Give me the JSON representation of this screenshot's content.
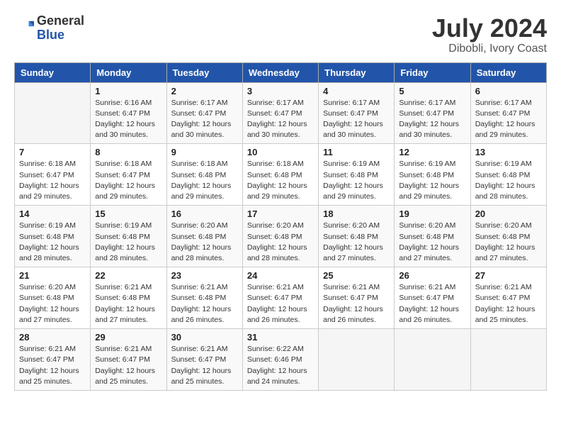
{
  "header": {
    "logo_general": "General",
    "logo_blue": "Blue",
    "month_year": "July 2024",
    "location": "Dibobli, Ivory Coast"
  },
  "days_of_week": [
    "Sunday",
    "Monday",
    "Tuesday",
    "Wednesday",
    "Thursday",
    "Friday",
    "Saturday"
  ],
  "weeks": [
    [
      {
        "day": "",
        "detail": ""
      },
      {
        "day": "1",
        "detail": "Sunrise: 6:16 AM\nSunset: 6:47 PM\nDaylight: 12 hours\nand 30 minutes."
      },
      {
        "day": "2",
        "detail": "Sunrise: 6:17 AM\nSunset: 6:47 PM\nDaylight: 12 hours\nand 30 minutes."
      },
      {
        "day": "3",
        "detail": "Sunrise: 6:17 AM\nSunset: 6:47 PM\nDaylight: 12 hours\nand 30 minutes."
      },
      {
        "day": "4",
        "detail": "Sunrise: 6:17 AM\nSunset: 6:47 PM\nDaylight: 12 hours\nand 30 minutes."
      },
      {
        "day": "5",
        "detail": "Sunrise: 6:17 AM\nSunset: 6:47 PM\nDaylight: 12 hours\nand 30 minutes."
      },
      {
        "day": "6",
        "detail": "Sunrise: 6:17 AM\nSunset: 6:47 PM\nDaylight: 12 hours\nand 29 minutes."
      }
    ],
    [
      {
        "day": "7",
        "detail": "Sunrise: 6:18 AM\nSunset: 6:47 PM\nDaylight: 12 hours\nand 29 minutes."
      },
      {
        "day": "8",
        "detail": "Sunrise: 6:18 AM\nSunset: 6:47 PM\nDaylight: 12 hours\nand 29 minutes."
      },
      {
        "day": "9",
        "detail": "Sunrise: 6:18 AM\nSunset: 6:48 PM\nDaylight: 12 hours\nand 29 minutes."
      },
      {
        "day": "10",
        "detail": "Sunrise: 6:18 AM\nSunset: 6:48 PM\nDaylight: 12 hours\nand 29 minutes."
      },
      {
        "day": "11",
        "detail": "Sunrise: 6:19 AM\nSunset: 6:48 PM\nDaylight: 12 hours\nand 29 minutes."
      },
      {
        "day": "12",
        "detail": "Sunrise: 6:19 AM\nSunset: 6:48 PM\nDaylight: 12 hours\nand 29 minutes."
      },
      {
        "day": "13",
        "detail": "Sunrise: 6:19 AM\nSunset: 6:48 PM\nDaylight: 12 hours\nand 28 minutes."
      }
    ],
    [
      {
        "day": "14",
        "detail": "Sunrise: 6:19 AM\nSunset: 6:48 PM\nDaylight: 12 hours\nand 28 minutes."
      },
      {
        "day": "15",
        "detail": "Sunrise: 6:19 AM\nSunset: 6:48 PM\nDaylight: 12 hours\nand 28 minutes."
      },
      {
        "day": "16",
        "detail": "Sunrise: 6:20 AM\nSunset: 6:48 PM\nDaylight: 12 hours\nand 28 minutes."
      },
      {
        "day": "17",
        "detail": "Sunrise: 6:20 AM\nSunset: 6:48 PM\nDaylight: 12 hours\nand 28 minutes."
      },
      {
        "day": "18",
        "detail": "Sunrise: 6:20 AM\nSunset: 6:48 PM\nDaylight: 12 hours\nand 27 minutes."
      },
      {
        "day": "19",
        "detail": "Sunrise: 6:20 AM\nSunset: 6:48 PM\nDaylight: 12 hours\nand 27 minutes."
      },
      {
        "day": "20",
        "detail": "Sunrise: 6:20 AM\nSunset: 6:48 PM\nDaylight: 12 hours\nand 27 minutes."
      }
    ],
    [
      {
        "day": "21",
        "detail": "Sunrise: 6:20 AM\nSunset: 6:48 PM\nDaylight: 12 hours\nand 27 minutes."
      },
      {
        "day": "22",
        "detail": "Sunrise: 6:21 AM\nSunset: 6:48 PM\nDaylight: 12 hours\nand 27 minutes."
      },
      {
        "day": "23",
        "detail": "Sunrise: 6:21 AM\nSunset: 6:48 PM\nDaylight: 12 hours\nand 26 minutes."
      },
      {
        "day": "24",
        "detail": "Sunrise: 6:21 AM\nSunset: 6:47 PM\nDaylight: 12 hours\nand 26 minutes."
      },
      {
        "day": "25",
        "detail": "Sunrise: 6:21 AM\nSunset: 6:47 PM\nDaylight: 12 hours\nand 26 minutes."
      },
      {
        "day": "26",
        "detail": "Sunrise: 6:21 AM\nSunset: 6:47 PM\nDaylight: 12 hours\nand 26 minutes."
      },
      {
        "day": "27",
        "detail": "Sunrise: 6:21 AM\nSunset: 6:47 PM\nDaylight: 12 hours\nand 25 minutes."
      }
    ],
    [
      {
        "day": "28",
        "detail": "Sunrise: 6:21 AM\nSunset: 6:47 PM\nDaylight: 12 hours\nand 25 minutes."
      },
      {
        "day": "29",
        "detail": "Sunrise: 6:21 AM\nSunset: 6:47 PM\nDaylight: 12 hours\nand 25 minutes."
      },
      {
        "day": "30",
        "detail": "Sunrise: 6:21 AM\nSunset: 6:47 PM\nDaylight: 12 hours\nand 25 minutes."
      },
      {
        "day": "31",
        "detail": "Sunrise: 6:22 AM\nSunset: 6:46 PM\nDaylight: 12 hours\nand 24 minutes."
      },
      {
        "day": "",
        "detail": ""
      },
      {
        "day": "",
        "detail": ""
      },
      {
        "day": "",
        "detail": ""
      }
    ]
  ]
}
